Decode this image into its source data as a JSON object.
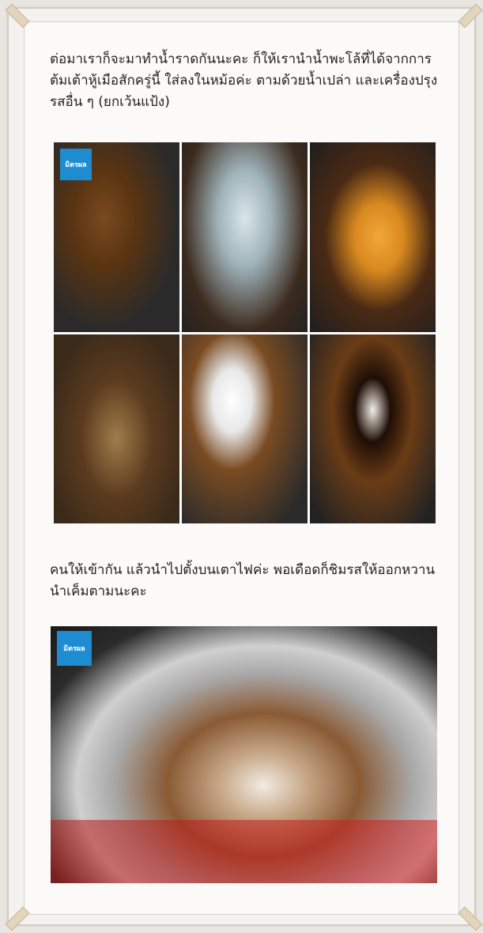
{
  "paragraphs": {
    "p1": "ต่อมาเราก็จะมาทำน้ำราดกันนะคะ ก็ให้เรานำน้ำพะโล้ที่ได้จากการต้มเต้าหู้เมือสักครู่นี้ ใส่ลงในหม้อค่ะ ตามด้วยน้ำเปล่า และเครื่องปรุงรสอื่น ๆ (ยกเว้นแป้ง)",
    "p2": "คนให้เข้ากัน แล้วนำไปตั้งบนเตาไฟค่ะ พอเดือดก็ชิมรสให้ออกหวานนำเค็มตามนะคะ"
  },
  "brand_logo_text": "มิตรผล",
  "photos": [
    {
      "name": "photo-pour-broth"
    },
    {
      "name": "photo-pour-water"
    },
    {
      "name": "photo-sugar-jar"
    },
    {
      "name": "photo-brown-sugar-bag"
    },
    {
      "name": "photo-salt-bowl"
    },
    {
      "name": "photo-soy-sauce-bowl"
    }
  ]
}
